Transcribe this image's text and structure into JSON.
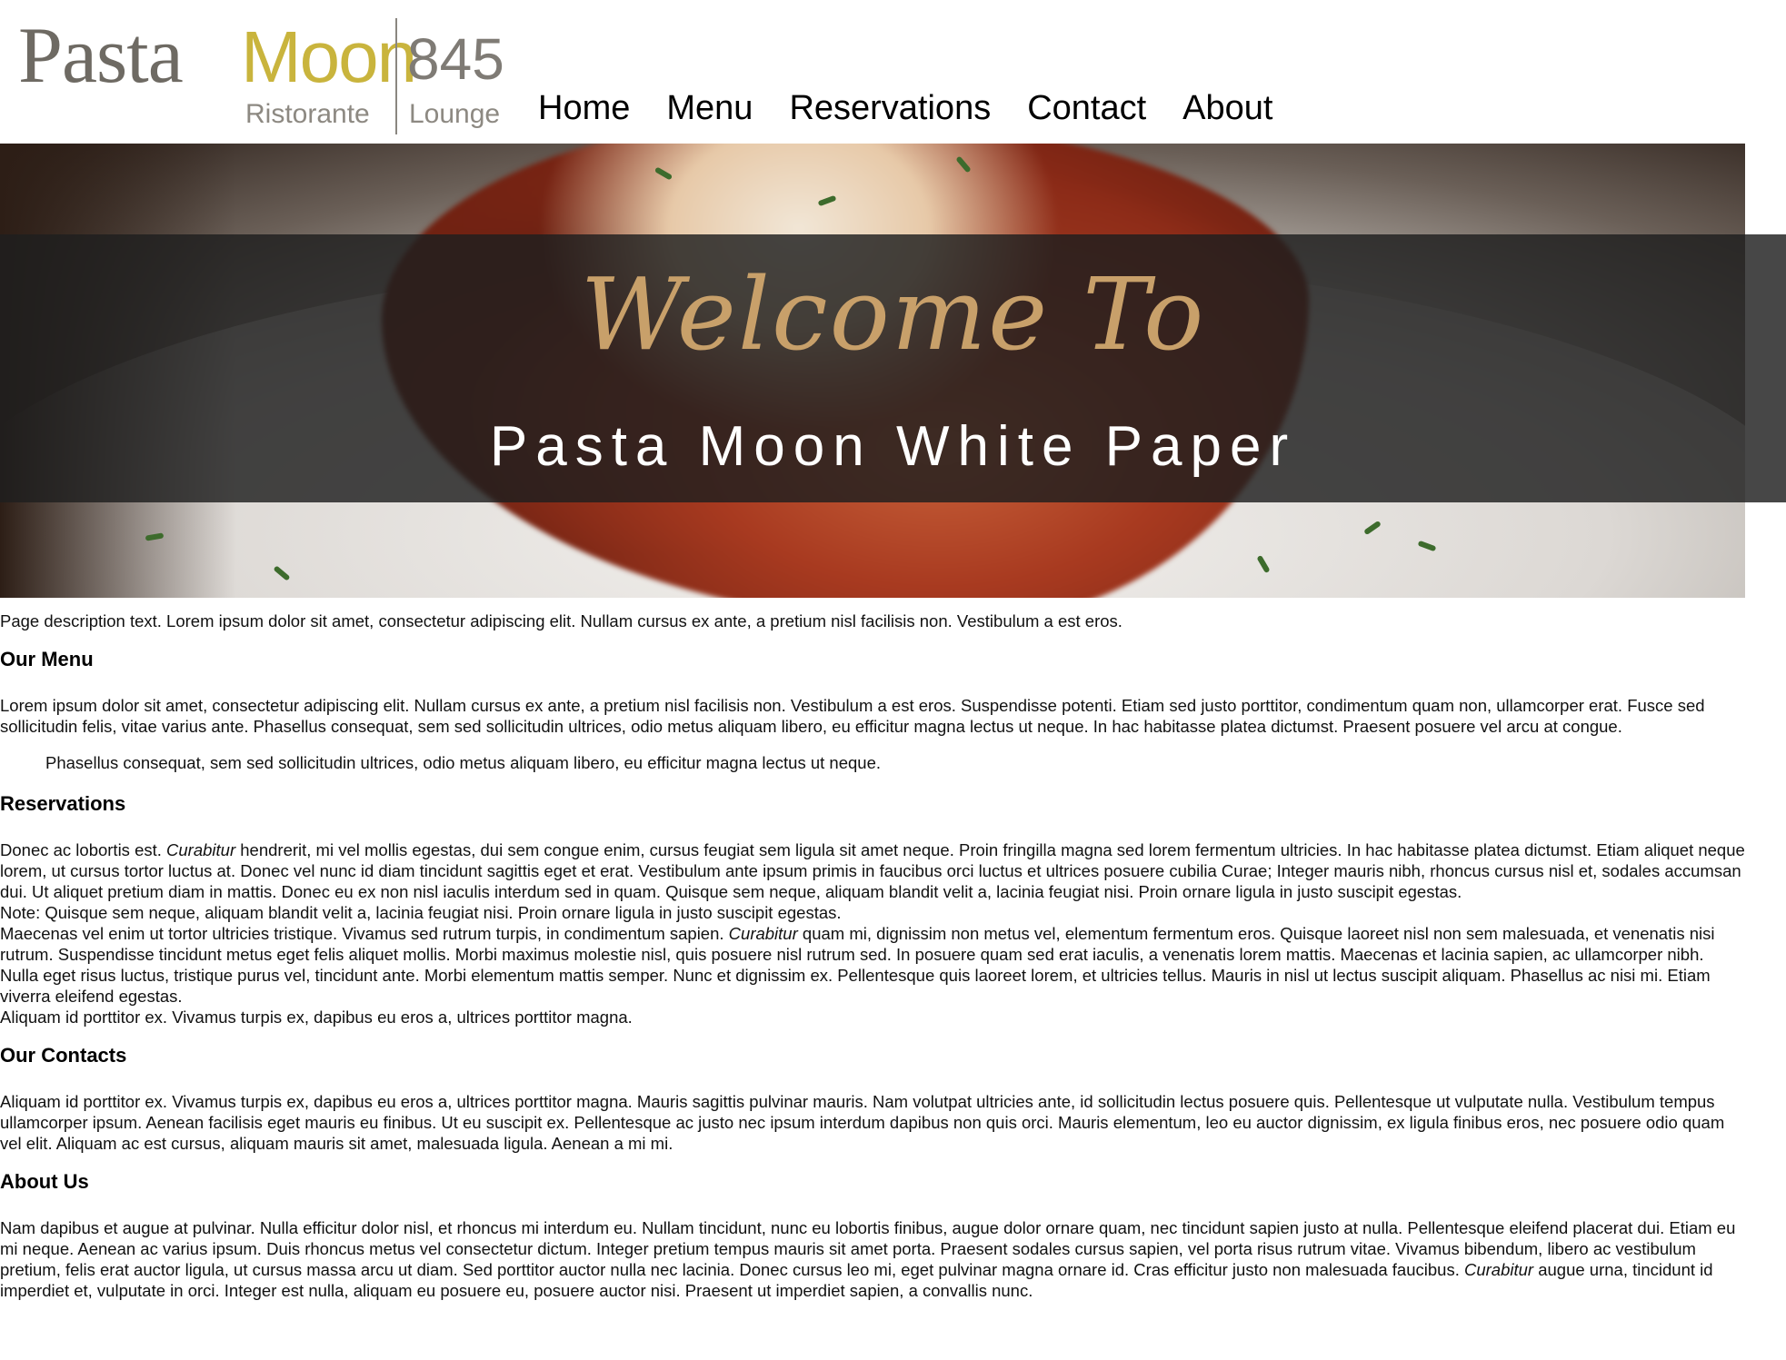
{
  "logo": {
    "pasta": "Pasta",
    "moon": "Moon",
    "number": "845",
    "ristorante": "Ristorante",
    "lounge": "Lounge"
  },
  "nav": {
    "items": [
      {
        "label": "Home"
      },
      {
        "label": "Menu"
      },
      {
        "label": "Reservations"
      },
      {
        "label": "Contact"
      },
      {
        "label": "About"
      }
    ]
  },
  "hero": {
    "script": "Welcome To",
    "title": "Pasta Moon White Paper",
    "script_color": "#c8a06a",
    "band_color": "#1e1e1e"
  },
  "content": {
    "intro": "Page description text. Lorem ipsum dolor sit amet, consectetur adipiscing elit. Nullam cursus ex ante, a pretium nisl facilisis non. Vestibulum a est eros.",
    "menu": {
      "heading": "Our Menu",
      "text": "Lorem ipsum dolor sit amet, consectetur adipiscing elit. Nullam cursus ex ante, a pretium nisl facilisis non. Vestibulum a est eros. Suspendisse potenti. Etiam sed justo porttitor, condimentum quam non, ullamcorper erat. Fusce sed sollicitudin felis, vitae varius ante. Phasellus consequat, sem sed sollicitudin ultrices, odio metus aliquam libero, eu efficitur magna lectus ut neque. In hac habitasse platea dictumst. Praesent posuere vel arcu at congue.",
      "quote": "Phasellus consequat, sem sed sollicitudin ultrices, odio metus aliquam libero, eu efficitur magna lectus ut neque."
    },
    "reservations": {
      "heading": "Reservations",
      "p1_start": "Donec ac lobortis est. ",
      "p1_em": "Curabitur",
      "p1_end": " hendrerit, mi vel mollis egestas, dui sem congue enim, cursus feugiat sem ligula sit amet neque. Proin fringilla magna sed lorem fermentum ultricies. In hac habitasse platea dictumst. Etiam aliquet neque lorem, ut cursus tortor luctus at. Donec vel nunc id diam tincidunt sagittis eget et erat. Vestibulum ante ipsum primis in faucibus orci luctus et ultrices posuere cubilia Curae; Integer mauris nibh, rhoncus cursus nisl et, sodales accumsan dui. Ut aliquet pretium diam in mattis. Donec eu ex non nisl iaculis interdum sed in quam. Quisque sem neque, aliquam blandit velit a, lacinia feugiat nisi. Proin ornare ligula in justo suscipit egestas.",
      "note": "Note: Quisque sem neque, aliquam blandit velit a, lacinia feugiat nisi. Proin ornare ligula in justo suscipit egestas.",
      "p2_start": "Maecenas vel enim ut tortor ultricies tristique. Vivamus sed rutrum turpis, in condimentum sapien. ",
      "p2_em": "Curabitur",
      "p2_end": " quam mi, dignissim non metus vel, elementum fermentum eros. Quisque laoreet nisl non sem malesuada, et venenatis nisi rutrum. Suspendisse tincidunt metus eget felis aliquet mollis. Morbi maximus molestie nisl, quis posuere nisl rutrum sed. In posuere quam sed erat iaculis, a venenatis lorem mattis. Maecenas et lacinia sapien, ac ullamcorper nibh. Nulla eget risus luctus, tristique purus vel, tincidunt ante. Morbi elementum mattis semper. Nunc et dignissim ex. Pellentesque quis laoreet lorem, et ultricies tellus. Mauris in nisl ut lectus suscipit aliquam. Phasellus ac nisi mi. Etiam viverra eleifend egestas.",
      "p3": "Aliquam id porttitor ex. Vivamus turpis ex, dapibus eu eros a, ultrices porttitor magna."
    },
    "contacts": {
      "heading": "Our Contacts",
      "text": "Aliquam id porttitor ex. Vivamus turpis ex, dapibus eu eros a, ultrices porttitor magna. Mauris sagittis pulvinar mauris. Nam volutpat ultricies ante, id sollicitudin lectus posuere quis. Pellentesque ut vulputate nulla. Vestibulum tempus ullamcorper ipsum. Aenean facilisis eget mauris eu finibus. Ut eu suscipit ex. Pellentesque ac justo nec ipsum interdum dapibus non quis orci. Mauris elementum, leo eu auctor dignissim, ex ligula finibus eros, nec posuere odio quam vel elit. Aliquam ac est cursus, aliquam mauris sit amet, malesuada ligula. Aenean a mi mi."
    },
    "about": {
      "heading": "About Us",
      "text_start": "Nam dapibus et augue at pulvinar. Nulla efficitur dolor nisl, et rhoncus mi interdum eu. Nullam tincidunt, nunc eu lobortis finibus, augue dolor ornare quam, nec tincidunt sapien justo at nulla. Pellentesque eleifend placerat dui. Etiam eu mi neque. Aenean ac varius ipsum. Duis rhoncus metus vel consectetur dictum. Integer pretium tempus mauris sit amet porta. Praesent sodales cursus sapien, vel porta risus rutrum vitae. Vivamus bibendum, libero ac vestibulum pretium, felis erat auctor ligula, ut cursus massa arcu ut diam. Sed porttitor auctor nulla nec lacinia. Donec cursus leo mi, eget pulvinar magna ornare id. Cras efficitur justo non malesuada faucibus. ",
      "text_em": "Curabitur",
      "text_end": " augue urna, tincidunt id imperdiet et, vulputate in orci. Integer est nulla, aliquam eu posuere eu, posuere auctor nisi. Praesent ut imperdiet sapien, a convallis nunc."
    }
  }
}
